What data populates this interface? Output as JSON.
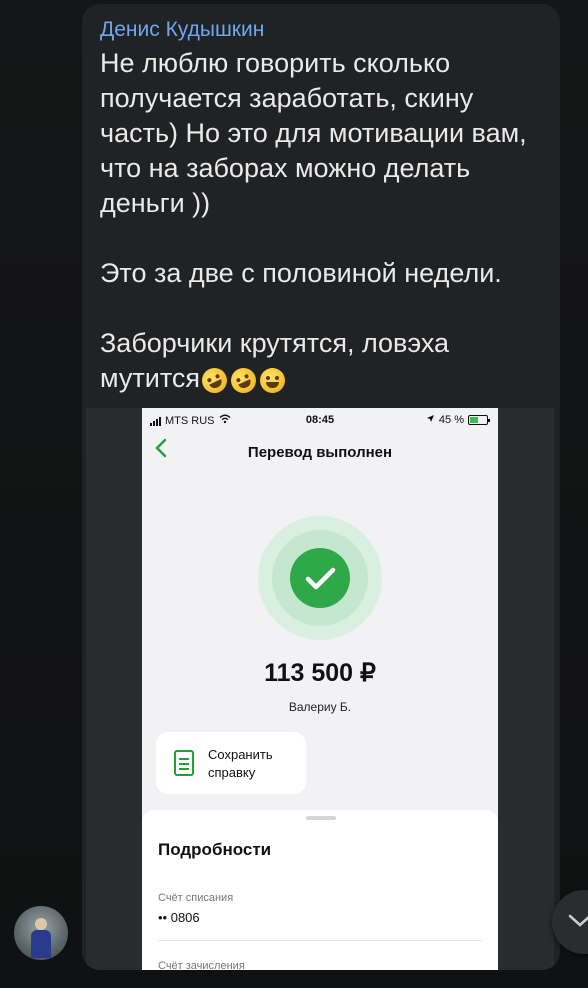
{
  "message": {
    "sender": "Денис Кудышкин",
    "paragraphs": [
      "Не люблю говорить сколько получается заработать, скину часть) Но это для мотивации вам, что на заборах можно делать деньги ))",
      "Это за две с половиной недели.",
      "Заборчики крутятся, ловэха мутится"
    ],
    "emojis": [
      "rolling-on-floor-laughing",
      "rolling-on-floor-laughing",
      "grinning-squinting"
    ]
  },
  "phone": {
    "status_bar": {
      "carrier": "MTS RUS",
      "time": "08:45",
      "battery": "45 %"
    },
    "title": "Перевод выполнен",
    "amount": "113 500 ₽",
    "recipient": "Валериу Б.",
    "save_button": "Сохранить справку",
    "details": {
      "title": "Подробности",
      "debit_label": "Счёт списания",
      "debit_value": "•• 0806",
      "credit_label": "Счёт зачисления"
    }
  },
  "colors": {
    "sender": "#6aa9f2",
    "accent_green": "#21a038",
    "bubble": "#202224"
  },
  "icons": [
    "back-chevron-icon",
    "check-icon",
    "document-icon",
    "chevron-down-icon"
  ]
}
